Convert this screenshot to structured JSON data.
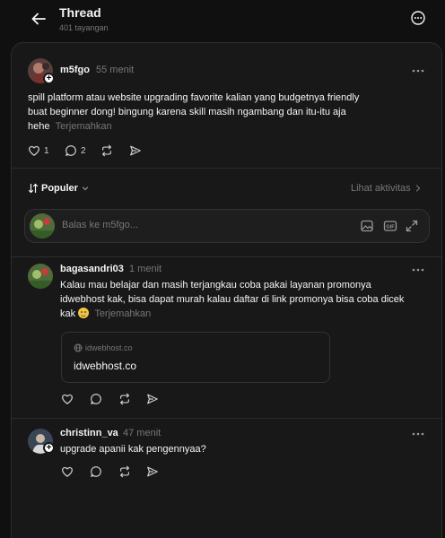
{
  "header": {
    "title": "Thread",
    "views": "401 tayangan"
  },
  "post": {
    "username": "m5fgo",
    "time": "55 menit",
    "text_line1": "spill platform atau website upgrading favorite kalian yang budgetnya friendly",
    "text_line2": "buat beginner dong! bingung karena skill masih ngambang dan itu-itu aja",
    "text_line3": "hehe",
    "translate": "Terjemahkan",
    "likes": "1",
    "comments": "2"
  },
  "sort": {
    "label": "Populer",
    "activity": "Lihat aktivitas"
  },
  "reply": {
    "placeholder": "Balas ke m5fgo..."
  },
  "replies": [
    {
      "username": "bagasandri03",
      "time": "1 menit",
      "text_line1": "Kalau mau belajar dan masih terjangkau coba pakai layanan promonya",
      "text_line2": "idwebhost kak, bisa dapat murah kalau daftar di link promonya bisa coba dicek",
      "text_line3": "kak",
      "translate": "Terjemahkan",
      "link": {
        "domain": "idwebhost.co",
        "title": "idwebhost.co"
      }
    },
    {
      "username": "christinn_va",
      "time": "47 menit",
      "text_line1": "upgrade apanii kak pengennyaa?"
    }
  ]
}
